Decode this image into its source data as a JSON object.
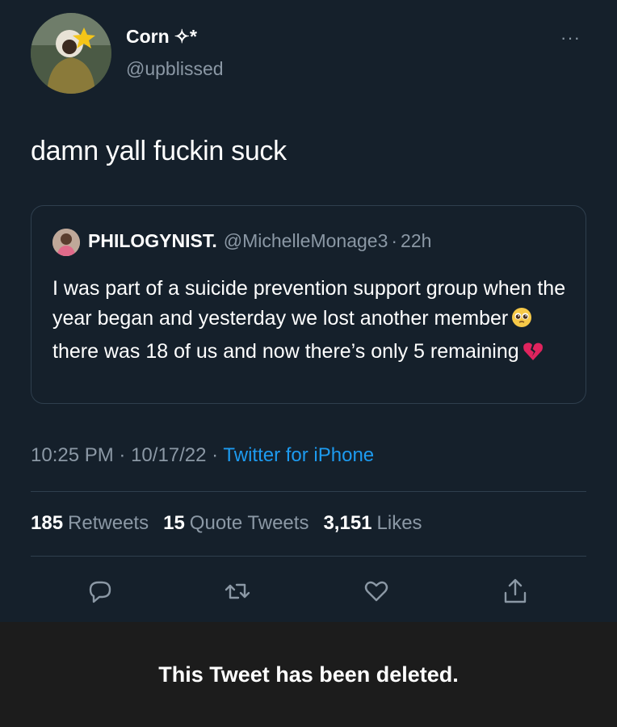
{
  "author": {
    "display_name": "Corn",
    "name_decoration": "✧*",
    "handle": "@upblissed"
  },
  "tweet": {
    "text": "damn yall fuckin suck"
  },
  "quoted": {
    "name": "PHILOGYNIST.",
    "handle": "@MichelleMonage3",
    "separator": "·",
    "age": "22h",
    "body_part1": "I was part of a suicide prevention support group when the year began and yesterday we lost another member",
    "body_part2": " there was 18 of us and now there’s only 5 remaining",
    "emoji1": "pleading-face-emoji",
    "emoji2": "broken-heart-emoji"
  },
  "meta": {
    "time": "10:25 PM",
    "sep1": "·",
    "date": "10/17/22",
    "sep2": "·",
    "source": "Twitter for iPhone"
  },
  "stats": {
    "retweets_count": "185",
    "retweets_label": "Retweets",
    "quotes_count": "15",
    "quotes_label": "Quote Tweets",
    "likes_count": "3,151",
    "likes_label": "Likes"
  },
  "actions": [
    "reply-icon",
    "retweet-icon",
    "like-icon",
    "share-icon"
  ],
  "more_menu": "···",
  "banner": {
    "text": "This Tweet has been deleted."
  },
  "colors": {
    "background": "#15202b",
    "secondary_text": "#8b98a5",
    "link": "#1d9bf0",
    "banner": "#1c1c1c"
  }
}
